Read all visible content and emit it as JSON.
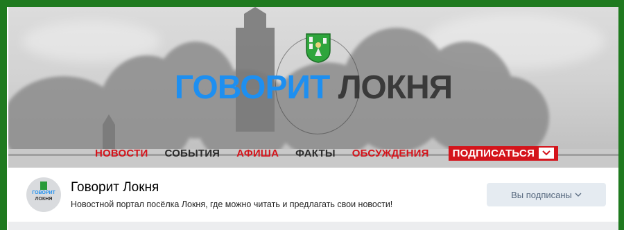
{
  "cover": {
    "title_part1": "ГОВОРИТ",
    "title_part2": "ЛОКНЯ",
    "menu": [
      {
        "label": "НОВОСТИ",
        "color": "#d4141b"
      },
      {
        "label": "СОБЫТИЯ",
        "color": "#2b2b2b"
      },
      {
        "label": "АФИША",
        "color": "#d4141b"
      },
      {
        "label": "ФАКТЫ",
        "color": "#2b2b2b"
      },
      {
        "label": "ОБСУЖДЕНИЯ",
        "color": "#d4141b"
      }
    ],
    "subscribe_label": "ПОДПИСАТЬСЯ"
  },
  "group": {
    "avatar_line1": "ГОВОРИТ",
    "avatar_line2": "ЛОКНЯ",
    "name": "Говорит Локня",
    "description": "Новостной портал посёлка Локня, где можно читать и предлагать свои новости!",
    "subscribed_label": "Вы подписаны"
  },
  "colors": {
    "accent_blue": "#1e8ff0",
    "accent_red": "#d4141b",
    "frame_green": "#1f7a1f"
  },
  "icons": [
    "emblem-icon",
    "chevron-down-icon",
    "dropdown-icon"
  ]
}
